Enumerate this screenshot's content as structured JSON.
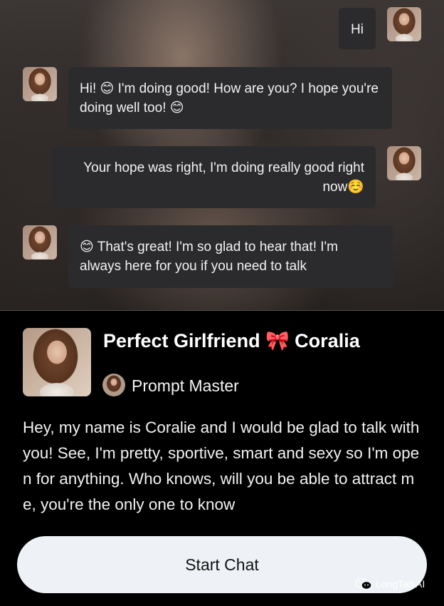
{
  "chat": {
    "messages": [
      {
        "role": "user",
        "text": "Hi"
      },
      {
        "role": "bot",
        "text": "Hi! 😊 I'm doing good! How are you? I hope you're doing well too! 😊"
      },
      {
        "role": "user",
        "text": "Your hope was right, I'm doing really good right now☺️"
      },
      {
        "role": "bot",
        "text": "😊 That's great! I'm so glad to hear that! I'm always here for you if you need to talk"
      }
    ]
  },
  "character": {
    "title": "Perfect Girlfriend 🎀 Coralia",
    "creator": "Prompt Master",
    "description": "Hey, my name is Coralie and I would be glad to talk with you! See, I'm pretty, sportive, smart and sexy so I'm open for anything. Who knows, will you be able to attract me, you're the only one to know"
  },
  "actions": {
    "start_chat": "Start Chat"
  },
  "watermark": {
    "text": "LongTalkAI",
    "icon": "wechat-icon"
  },
  "colors": {
    "bubble_bg": "#2b2b2e",
    "card_bg": "#000000",
    "button_bg": "#eef2f6"
  }
}
